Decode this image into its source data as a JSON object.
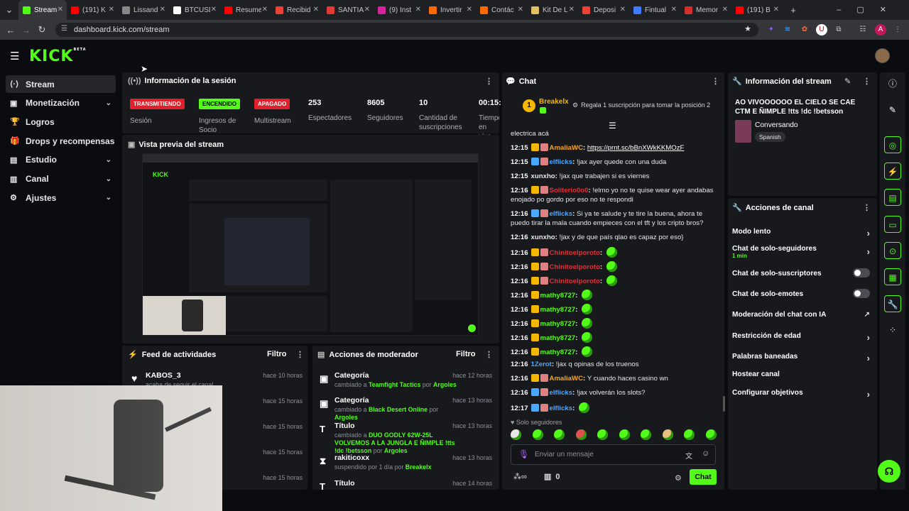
{
  "browser": {
    "tabs": [
      {
        "title": "Stream",
        "color": "#53fc18"
      },
      {
        "title": "(191) K",
        "color": "#ff0000"
      },
      {
        "title": "Lissand",
        "color": "#888888"
      },
      {
        "title": "BTCUSD",
        "color": "#ffffff"
      },
      {
        "title": "Resume",
        "color": "#ff0000"
      },
      {
        "title": "Recibid",
        "color": "#ea4335"
      },
      {
        "title": "SANTIA",
        "color": "#e53935"
      },
      {
        "title": "(9) Inst",
        "color": "#d6249f"
      },
      {
        "title": "Invertir",
        "color": "#ff6a00"
      },
      {
        "title": "Contác",
        "color": "#ff6a00"
      },
      {
        "title": "Kit De L",
        "color": "#e0c060"
      },
      {
        "title": "Deposi",
        "color": "#ea4335"
      },
      {
        "title": "Fintual",
        "color": "#3f7bff"
      },
      {
        "title": "Memor",
        "color": "#d32f2f"
      },
      {
        "title": "(191) B",
        "color": "#ff0000"
      }
    ],
    "new_tab": "+",
    "url": "dashboard.kick.com/stream"
  },
  "kick": {
    "logo": "KICK",
    "beta": "BETA"
  },
  "sidebar": {
    "items": [
      {
        "label": "Stream",
        "icon": "stream-icon"
      },
      {
        "label": "Monetización",
        "icon": "money-icon"
      },
      {
        "label": "Logros",
        "icon": "trophy-icon"
      },
      {
        "label": "Drops y recompensas",
        "icon": "gift-icon"
      },
      {
        "label": "Estudio",
        "icon": "studio-icon"
      },
      {
        "label": "Canal",
        "icon": "channel-icon"
      },
      {
        "label": "Ajustes",
        "icon": "gear-icon"
      }
    ]
  },
  "session": {
    "title": "Información de la sesión",
    "badges": [
      {
        "label": "TRANSMITIENDO",
        "caption": "Sesión",
        "color": "#e0202a"
      },
      {
        "label": "ENCENDIDO",
        "caption": "Ingresos de Socio",
        "color": "#53fc18"
      },
      {
        "label": "APAGADO",
        "caption": "Multistream",
        "color": "#e0202a"
      }
    ],
    "stats": [
      {
        "value": "253",
        "label": "Espectadores"
      },
      {
        "value": "8605",
        "label": "Seguidores"
      },
      {
        "value": "10",
        "label": "Cantidad de suscripciones"
      },
      {
        "value": "00:15:",
        "label": "Tiempo en vivo"
      }
    ]
  },
  "preview": {
    "title": "Vista previa del stream"
  },
  "feed": {
    "title": "Feed de actividades",
    "filter": "Filtro",
    "rows": [
      {
        "name": "KABOS_3",
        "sub": "acaba de seguir el canal",
        "time": "hace 10 horas"
      },
      {
        "name": "",
        "sub": "",
        "time": "hace 15 horas"
      },
      {
        "name": "",
        "sub": "",
        "time": "hace 15 horas"
      },
      {
        "name": "",
        "sub": "",
        "time": "hace 15 horas"
      },
      {
        "name": "",
        "sub": "",
        "time": "hace 15 horas"
      }
    ]
  },
  "modactions": {
    "title": "Acciones de moderador",
    "filter": "Filtro",
    "rows": [
      {
        "title": "Categoría",
        "pre": "cambiado a ",
        "target": "Teamfight Tactics",
        "by": " por ",
        "user": "Argoles",
        "time": "hace 12 horas"
      },
      {
        "title": "Categoría",
        "pre": "cambiado a ",
        "target": "Black Desert Online",
        "by": " por ",
        "user": "Argoles",
        "time": "hace 13 horas"
      },
      {
        "title": "Título",
        "pre": "cambiado a ",
        "target": "DUO GODLY 62W-25L VOLVEMOS A LA JUNGLA E ÑIMPLE !tts !dc !betsson",
        "by": " por ",
        "user": "Argoles",
        "time": "hace 13 horas"
      },
      {
        "title": "rakiticoxx",
        "pre": "suspendido por 1 día por ",
        "target": "",
        "by": "",
        "user": "Breakelx",
        "time": "hace 13 horas"
      },
      {
        "title": "Título",
        "pre": "",
        "target": "",
        "by": "",
        "user": "",
        "time": "hace 14 horas"
      }
    ]
  },
  "chat": {
    "title": "Chat",
    "pinned_user": "Breakelx",
    "pinned_rank": "1",
    "pinned_msg": "Regala 1 suscripción para tomar la posición 2",
    "first_line": "electrica acá",
    "messages": [
      {
        "time": "12:15",
        "user": "AmaliaWC",
        "color": "#f5a524",
        "text": "https://prnt.sc/bBnXWkKKMOzF",
        "link": true
      },
      {
        "time": "12:15",
        "user": "elflicks",
        "color": "#4aa8ff",
        "text": "!jax ayer quede con una duda"
      },
      {
        "time": "12:15",
        "user": "xunxho",
        "color": "#e6e7ea",
        "text": "!jax que trabajen si es viernes"
      },
      {
        "time": "12:16",
        "user": "Soliterio0o0",
        "color": "#e0303a",
        "text": "!elmo yo no te quise wear ayer andabas enojado po gordo por eso no te respondi"
      },
      {
        "time": "12:16",
        "user": "elflicks",
        "color": "#4aa8ff",
        "text": "Si ya te salude y te tire la buena, ahora te puedo tirar la mala cuando empieces con el tft y los cripto bros?"
      },
      {
        "time": "12:16",
        "user": "xunxho",
        "color": "#e6e7ea",
        "text": "!jax y de que país qlao es capaz por eso}"
      },
      {
        "time": "12:16",
        "user": "Chinitoelporoto",
        "color": "#e0303a",
        "text": ""
      },
      {
        "time": "12:16",
        "user": "Chinitoelporoto",
        "color": "#e0303a",
        "text": ""
      },
      {
        "time": "12:16",
        "user": "Chinitoelporoto",
        "color": "#e0303a",
        "text": ""
      },
      {
        "time": "12:16",
        "user": "mathy8727",
        "color": "#53fc18",
        "text": ""
      },
      {
        "time": "12:16",
        "user": "mathy8727",
        "color": "#53fc18",
        "text": ""
      },
      {
        "time": "12:16",
        "user": "mathy8727",
        "color": "#53fc18",
        "text": ""
      },
      {
        "time": "12:16",
        "user": "mathy8727",
        "color": "#53fc18",
        "text": ""
      },
      {
        "time": "12:16",
        "user": "mathy8727",
        "color": "#53fc18",
        "text": ""
      },
      {
        "time": "12:16",
        "user": "1Zerot",
        "color": "#4aa8ff",
        "text": "!jax q opinas de los truenos"
      },
      {
        "time": "12:16",
        "user": "AmaliaWC",
        "color": "#f5a524",
        "text": "Y cuando haces casino wn"
      },
      {
        "time": "12:16",
        "user": "elflicks",
        "color": "#4aa8ff",
        "text": "!jax volverán los slots?"
      },
      {
        "time": "12:17",
        "user": "elflicks",
        "color": "#4aa8ff",
        "text": ""
      }
    ],
    "followers_only": "Solo seguidores",
    "input_placeholder": "Enviar un mensaje",
    "points": "∞",
    "gift_count": "0",
    "send": "Chat"
  },
  "streaminfo": {
    "title": "Información del stream",
    "stream_title": "AO VIVOOOOOO EL CIELO SE CAE CTM E ÑIMPLE !tts !dc !betsson",
    "category": "Conversando",
    "language": "Spanish"
  },
  "channelactions": {
    "title": "Acciones de canal",
    "items": [
      {
        "label": "Modo lento",
        "kind": "arrow",
        "sub": ""
      },
      {
        "label": "Chat de solo-seguidores",
        "kind": "arrow",
        "sub": "1 min"
      },
      {
        "label": "Chat de solo-suscriptores",
        "kind": "toggle",
        "sub": ""
      },
      {
        "label": "Chat de solo-emotes",
        "kind": "toggle",
        "sub": ""
      },
      {
        "label": "Moderación del chat con IA",
        "kind": "ext",
        "sub": ""
      },
      {
        "label": "Restricción de edad",
        "kind": "arrow",
        "sub": ""
      },
      {
        "label": "Palabras baneadas",
        "kind": "arrow",
        "sub": ""
      },
      {
        "label": "Hostear canal",
        "kind": "none",
        "sub": ""
      },
      {
        "label": "Configurar objetivos",
        "kind": "arrow",
        "sub": ""
      }
    ]
  }
}
